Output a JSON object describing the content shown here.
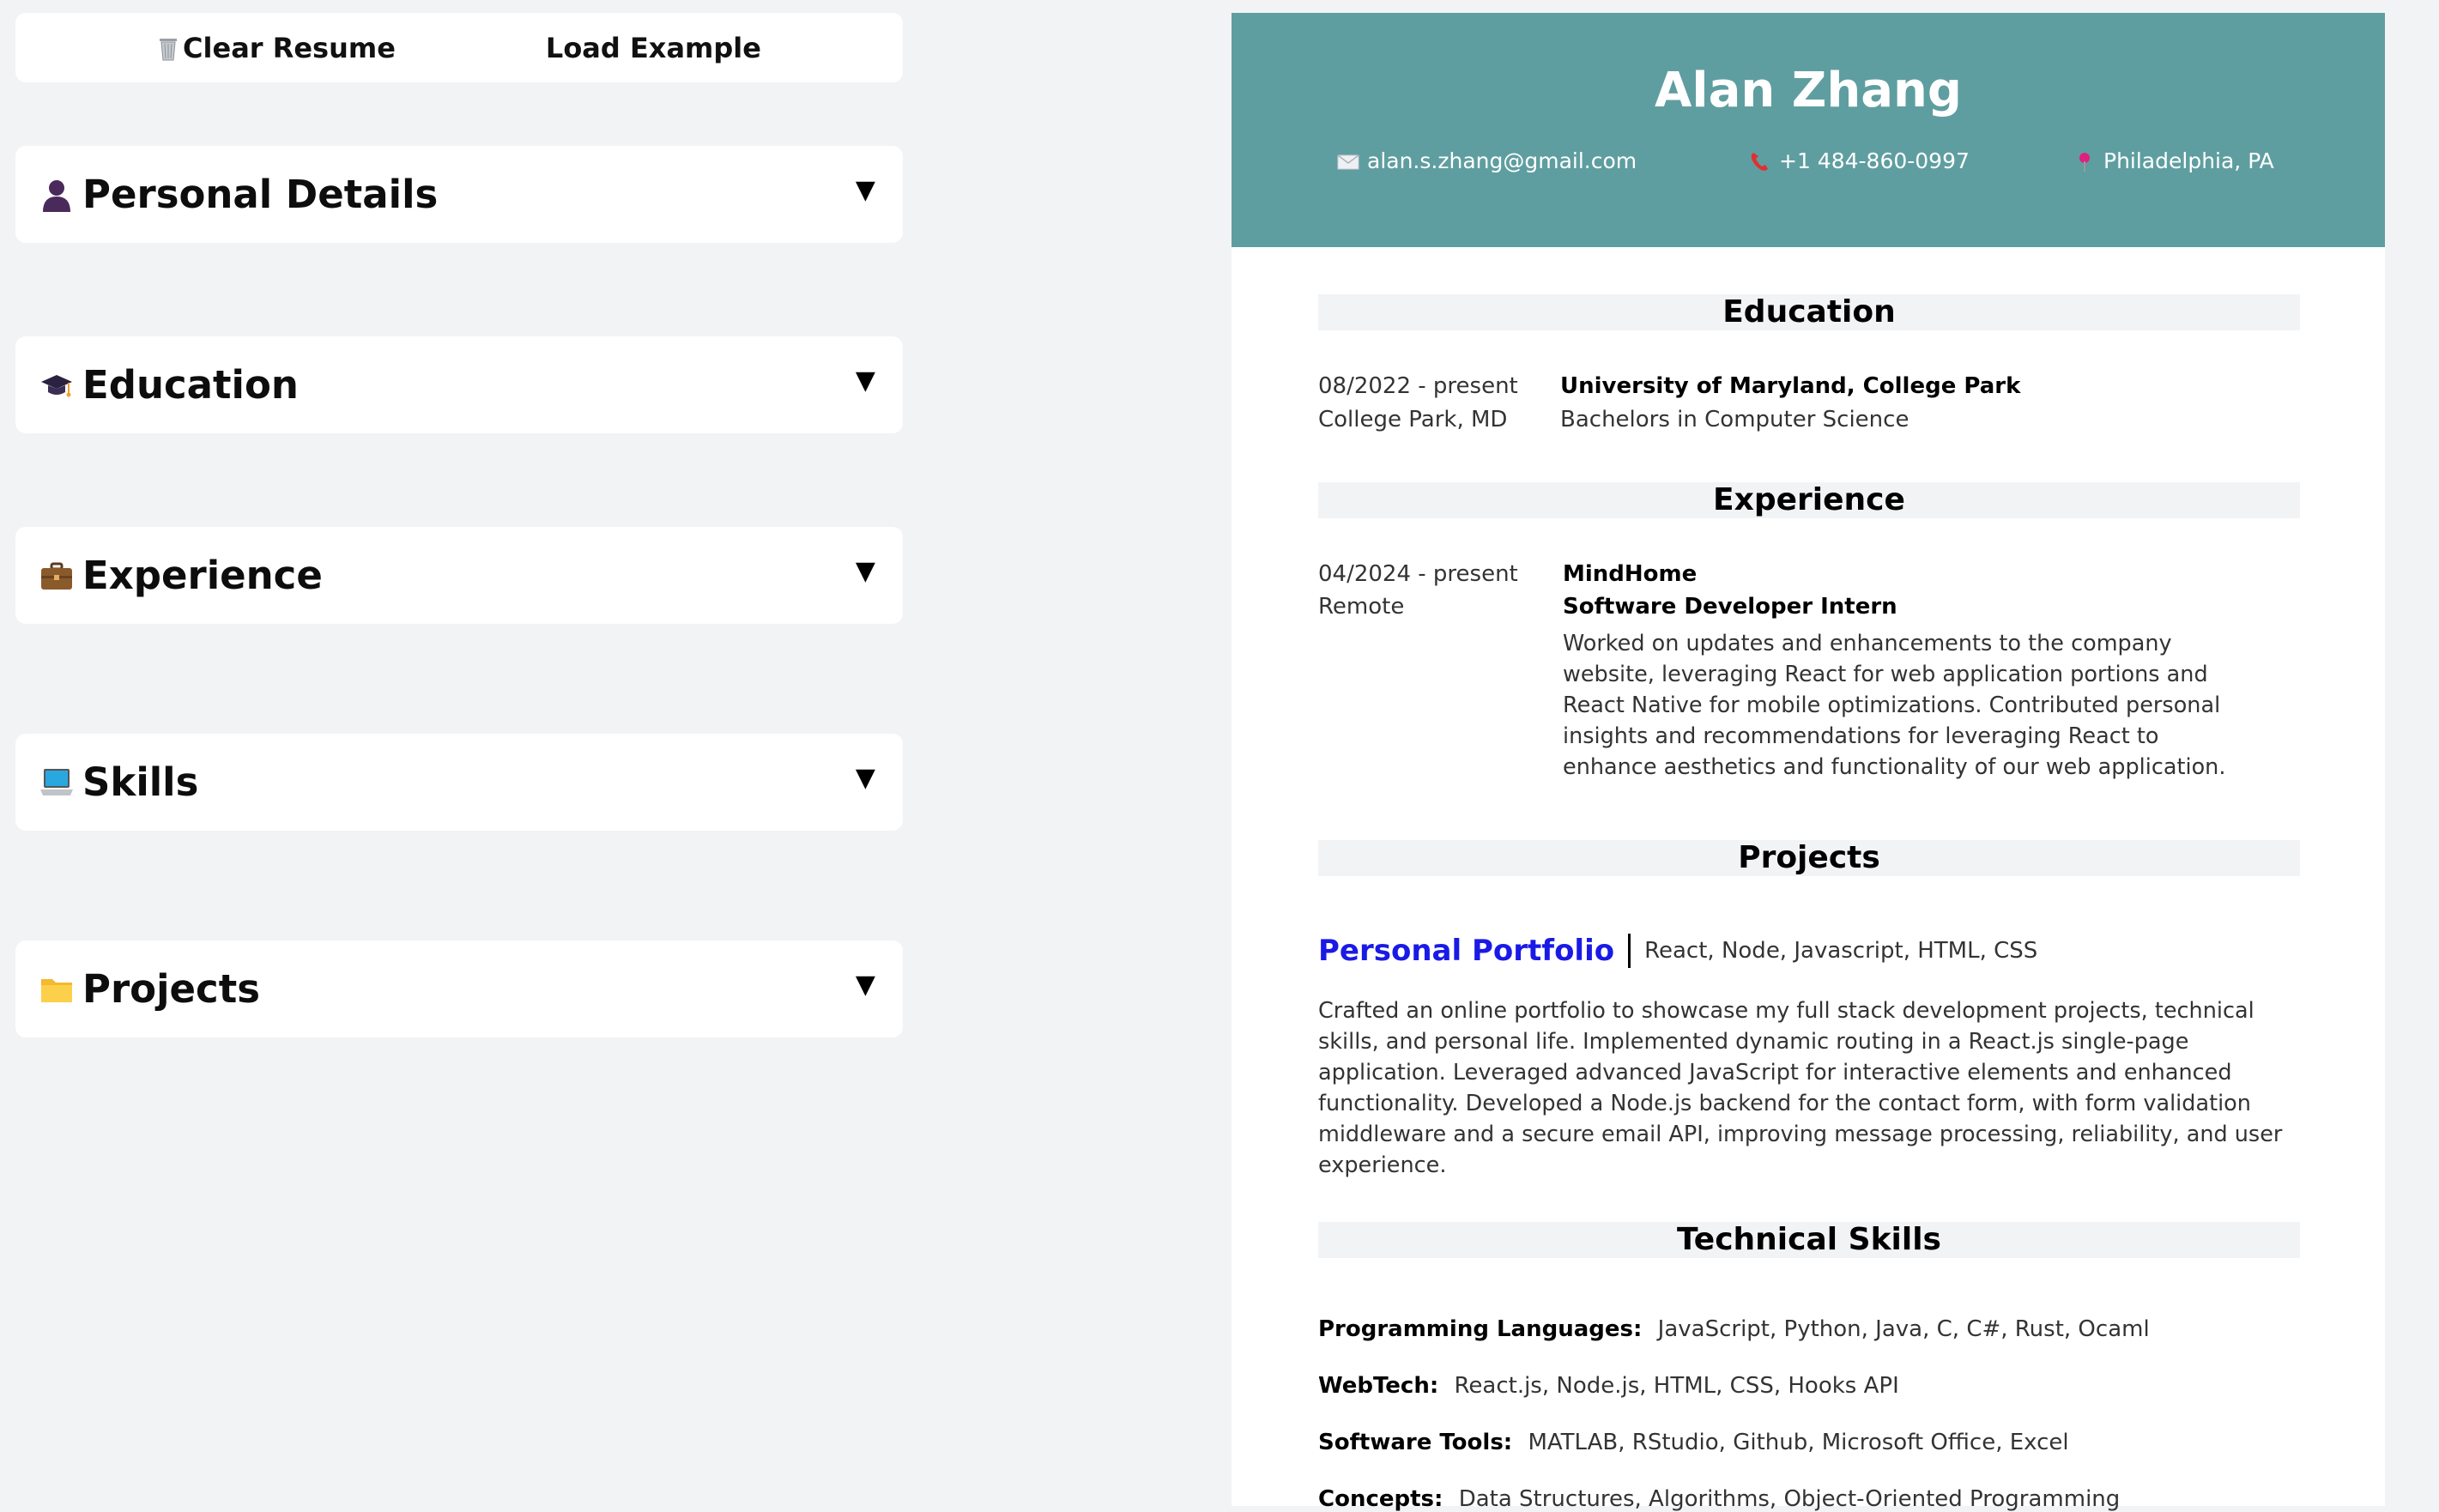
{
  "toolbar": {
    "clear_label": "Clear Resume",
    "load_label": "Load Example"
  },
  "sections": [
    {
      "title": "Personal Details",
      "icon": "bust-icon"
    },
    {
      "title": "Education",
      "icon": "graduation-cap-icon"
    },
    {
      "title": "Experience",
      "icon": "briefcase-icon"
    },
    {
      "title": "Skills",
      "icon": "laptop-icon"
    },
    {
      "title": "Projects",
      "icon": "folder-icon"
    }
  ],
  "chevron": "▼",
  "colors": {
    "header_bg": "#5f9ea0",
    "section_bar_bg": "#f2f3f5",
    "page_bg": "#f2f3f5",
    "link": "#1a1ae6"
  },
  "resume": {
    "name": "Alan Zhang",
    "email": "alan.s.zhang@gmail.com",
    "phone": "+1 484-860-0997",
    "location": "Philadelphia, PA",
    "education": {
      "heading": "Education",
      "dates": "08/2022 - present",
      "place": "College Park, MD",
      "school": "University of Maryland, College Park",
      "degree": "Bachelors in Computer Science"
    },
    "experience": {
      "heading": "Experience",
      "dates": "04/2024 - present",
      "place": "Remote",
      "company": "MindHome",
      "role": "Software Developer Intern",
      "description": "Worked on updates and enhancements to the company website, leveraging React for web application portions and React Native for mobile optimizations. Contributed personal insights and recommendations for leveraging React to enhance aesthetics and functionality of our web application."
    },
    "projects": {
      "heading": "Projects",
      "name": "Personal Portfolio",
      "tech": "React, Node, Javascript, HTML, CSS",
      "description": "Crafted an online portfolio to showcase my full stack development projects, technical skills, and personal life. Implemented dynamic routing in a React.js single-page application. Leveraged advanced JavaScript for interactive elements and enhanced functionality. Developed a Node.js backend for the contact form, with form validation middleware and a secure email API, improving message processing, reliability, and user experience."
    },
    "skills": {
      "heading": "Technical Skills",
      "rows": [
        {
          "label": "Programming Languages:",
          "value": "JavaScript, Python, Java, C, C#, Rust, Ocaml"
        },
        {
          "label": "WebTech:",
          "value": "React.js, Node.js, HTML, CSS, Hooks API"
        },
        {
          "label": "Software Tools:",
          "value": "MATLAB, RStudio, Github, Microsoft Office, Excel"
        },
        {
          "label": "Concepts:",
          "value": "Data Structures, Algorithms, Object-Oriented Programming"
        }
      ]
    }
  }
}
